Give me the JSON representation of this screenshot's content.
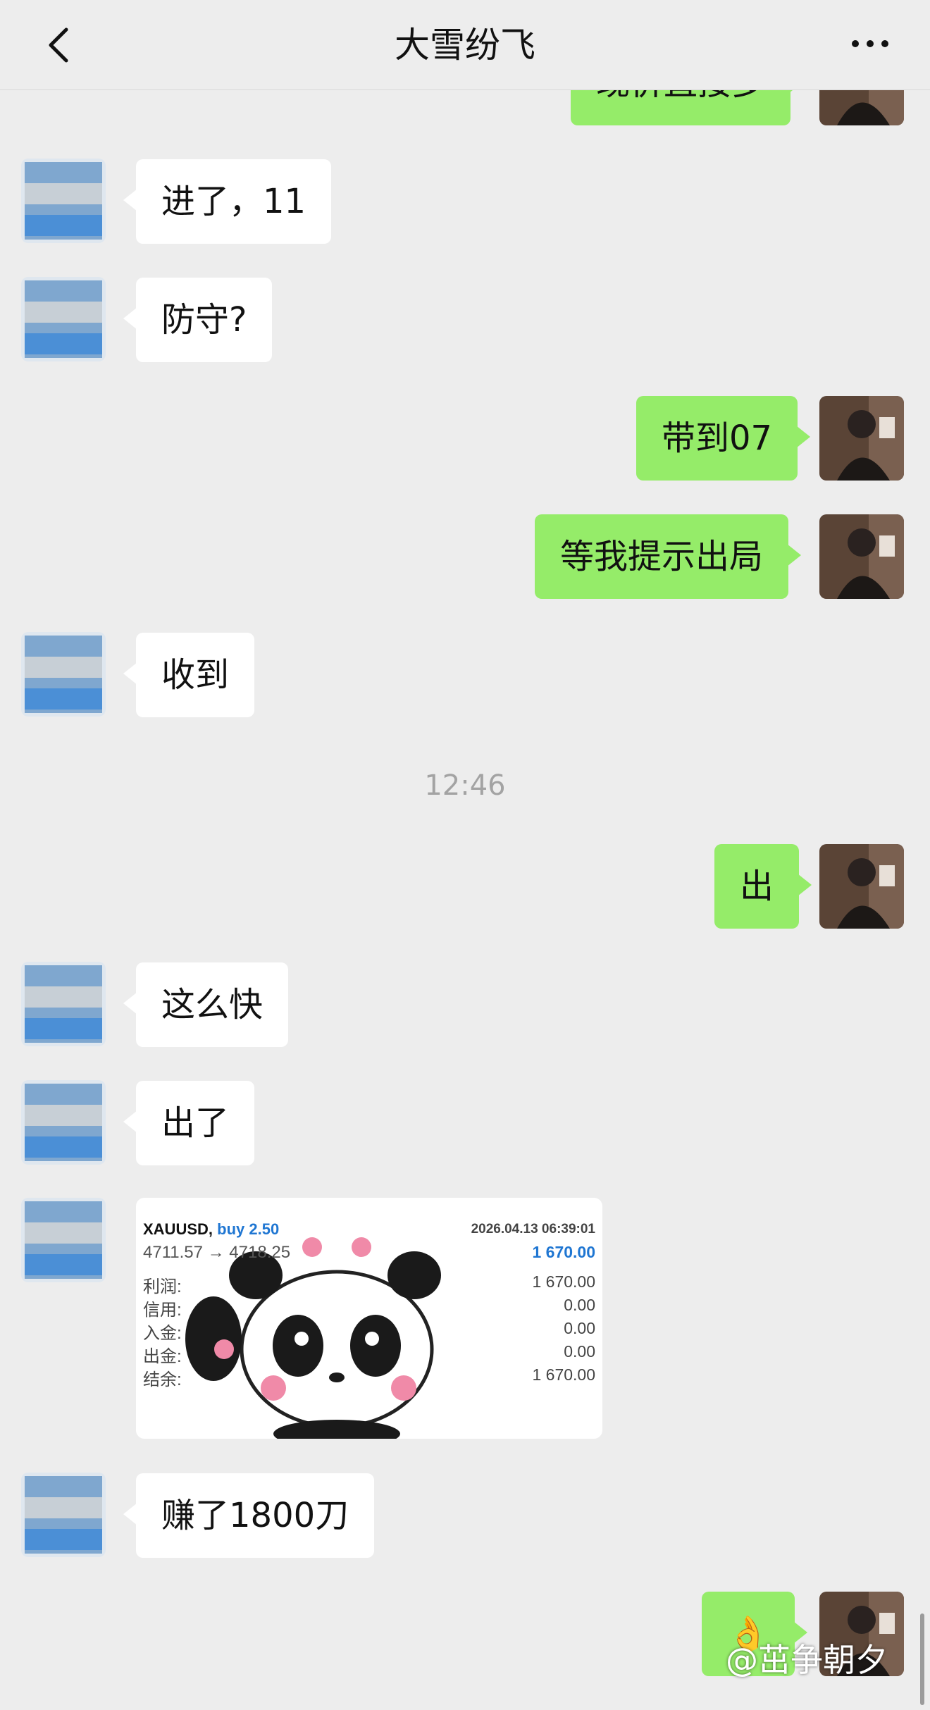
{
  "header": {
    "title": "大雪纷飞"
  },
  "timestamp": "12:46",
  "messages": [
    {
      "side": "self",
      "text": "现价直接多"
    },
    {
      "side": "other",
      "text": "进了，11"
    },
    {
      "side": "other",
      "text": "防守?"
    },
    {
      "side": "self",
      "text": "带到07"
    },
    {
      "side": "self",
      "text": "等我提示出局"
    },
    {
      "side": "other",
      "text": "收到"
    },
    {
      "side": "self",
      "text": "出"
    },
    {
      "side": "other",
      "text": "这么快"
    },
    {
      "side": "other",
      "text": "出了"
    },
    {
      "side": "other",
      "text": "赚了1800刀"
    },
    {
      "side": "self",
      "text": "👌"
    }
  ],
  "trade": {
    "symbol": "XAUUSD,",
    "side": "buy 2.50",
    "datetime": "2026.04.13 06:39:01",
    "prices": "4711.57 → 4718.25",
    "profit_top": "1 670.00",
    "rows": [
      {
        "label": "利润:",
        "value": "1 670.00"
      },
      {
        "label": "信用:",
        "value": "0.00"
      },
      {
        "label": "入金:",
        "value": "0.00"
      },
      {
        "label": "出金:",
        "value": "0.00"
      },
      {
        "label": "结余:",
        "value": "1 670.00"
      }
    ]
  },
  "watermark": "@茁争朝夕",
  "colors": {
    "self_bubble": "#95ec69",
    "other_bubble": "#ffffff",
    "background": "#ededed",
    "accent_blue": "#1f76d2"
  },
  "icons": {
    "back": "chevron-left-icon",
    "more": "more-dots-icon"
  }
}
